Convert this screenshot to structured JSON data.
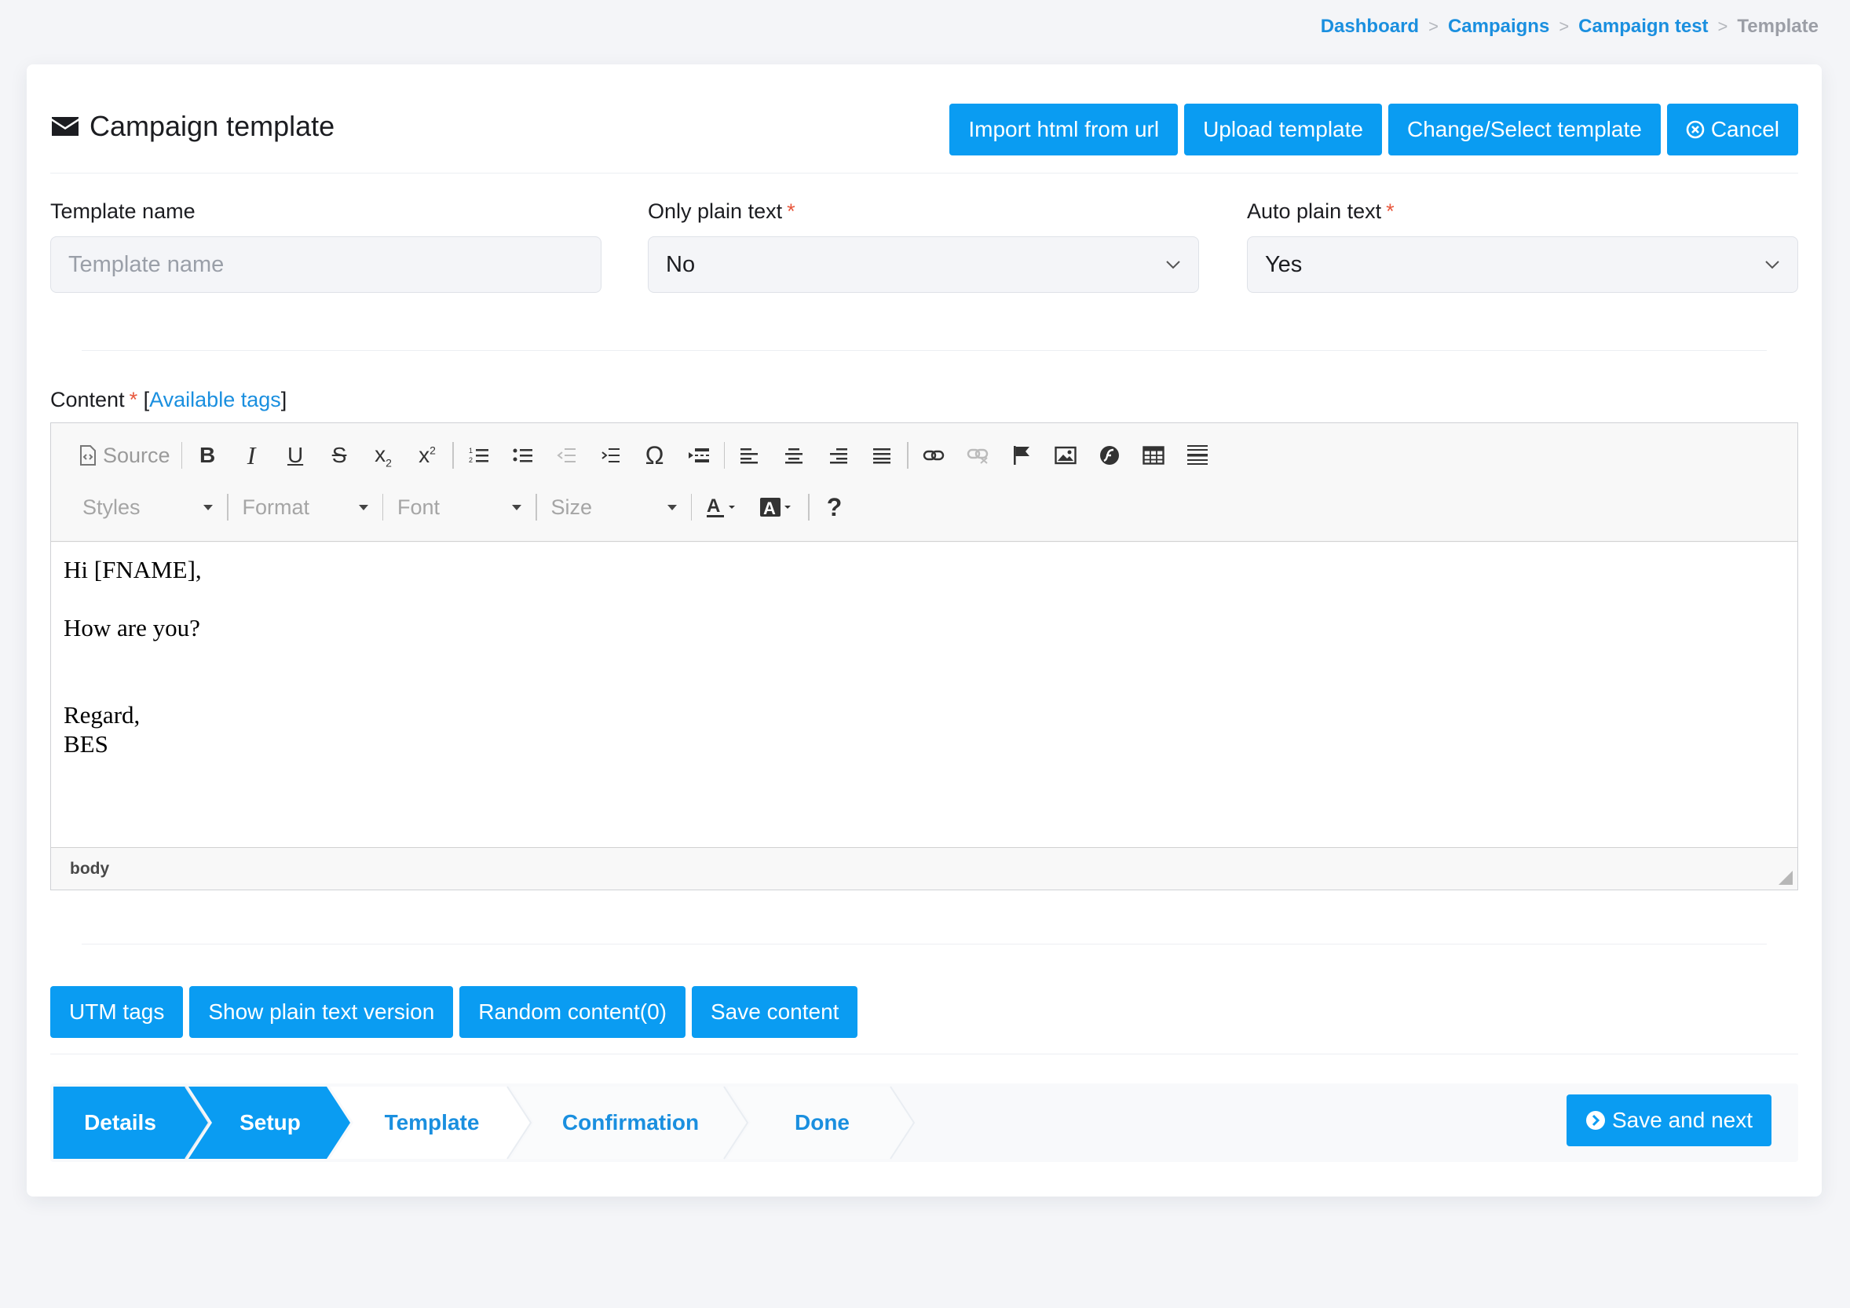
{
  "breadcrumb": {
    "items": [
      "Dashboard",
      "Campaigns",
      "Campaign test"
    ],
    "separator": ">",
    "current": "Template"
  },
  "header": {
    "title": "Campaign template",
    "title_icon": "envelope-icon",
    "buttons": {
      "import": "Import html from url",
      "upload": "Upload template",
      "change": "Change/Select template",
      "cancel": "Cancel"
    }
  },
  "form": {
    "template_name": {
      "label": "Template name",
      "placeholder": "Template name",
      "value": ""
    },
    "only_plain_text": {
      "label": "Only plain text",
      "required_mark": "*",
      "value": "No"
    },
    "auto_plain_text": {
      "label": "Auto plain text",
      "required_mark": "*",
      "value": "Yes"
    }
  },
  "content": {
    "label": "Content",
    "required_mark": "*",
    "tags_open": "[",
    "tags_link": "Available tags",
    "tags_close": "]"
  },
  "editor": {
    "source_label": "Source",
    "combos": {
      "styles": "Styles",
      "format": "Format",
      "font": "Font",
      "size": "Size"
    },
    "body": {
      "line1": "Hi [FNAME],",
      "line2": "How are you?",
      "line3": "Regard,",
      "line4": "BES"
    },
    "footer_path": "body"
  },
  "actions": {
    "utm": "UTM tags",
    "plain": "Show plain text version",
    "random": "Random content(0)",
    "save": "Save content"
  },
  "wizard": {
    "steps": [
      "Details",
      "Setup",
      "Template",
      "Confirmation",
      "Done"
    ],
    "active_count": 2,
    "save_next": "Save and next"
  },
  "colors": {
    "primary": "#0a9cf2",
    "link": "#1a8fdf",
    "required": "#e8583d",
    "text": "#1c1d21"
  }
}
